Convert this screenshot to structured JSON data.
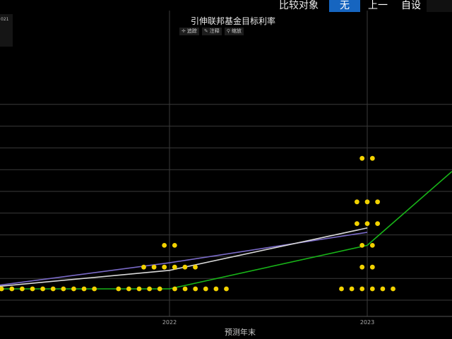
{
  "topbar": {
    "compare_label": "比较对象",
    "none_label": "无",
    "prev_label": "上一",
    "custom_label": "自设"
  },
  "left_stub_text": "021",
  "toolbar": {
    "track_label": "追踪",
    "annotate_label": "注释",
    "zoom_label": "缩放"
  },
  "colors": {
    "dots": "#f2d200",
    "green_line": "#18b418",
    "white_line": "#d8d8d8",
    "purple_line": "#7a6ac8",
    "grid": "#3a3a3a",
    "active_button": "#1665c0"
  },
  "chart_data": {
    "type": "scatter",
    "title": "引伸联邦基金目标利率",
    "xlabel": "预测年末",
    "ylabel": "",
    "x_ticks": [
      "2022",
      "2023"
    ],
    "grid": true,
    "dot_plot": [
      {
        "x": "2021",
        "level": 0,
        "count": 13
      },
      {
        "x": "2022",
        "level": 0,
        "count": 5
      },
      {
        "x": "2022",
        "level": 0,
        "count": 6
      },
      {
        "x": "2022",
        "level": 1,
        "count": 6
      },
      {
        "x": "2022",
        "level": 2,
        "count": 2
      },
      {
        "x": "2023",
        "level": 0,
        "count": 6
      },
      {
        "x": "2023",
        "level": 1,
        "count": 2
      },
      {
        "x": "2023",
        "level": 2,
        "count": 2
      },
      {
        "x": "2023",
        "level": 3,
        "count": 3
      },
      {
        "x": "2023",
        "level": 4,
        "count": 3
      },
      {
        "x": "2023",
        "level": 6,
        "count": 2
      }
    ],
    "series": [
      {
        "values": [
          [
            0,
            0
          ],
          [
            1,
            1.2
          ],
          [
            2,
            2.6
          ]
        ]
      },
      {
        "values": [
          [
            0,
            0
          ],
          [
            1,
            0.85
          ],
          [
            2,
            2.8
          ]
        ]
      },
      {
        "values": [
          [
            0,
            0
          ],
          [
            1,
            0
          ],
          [
            2,
            2
          ],
          [
            2.4,
            5.4
          ]
        ]
      }
    ]
  }
}
